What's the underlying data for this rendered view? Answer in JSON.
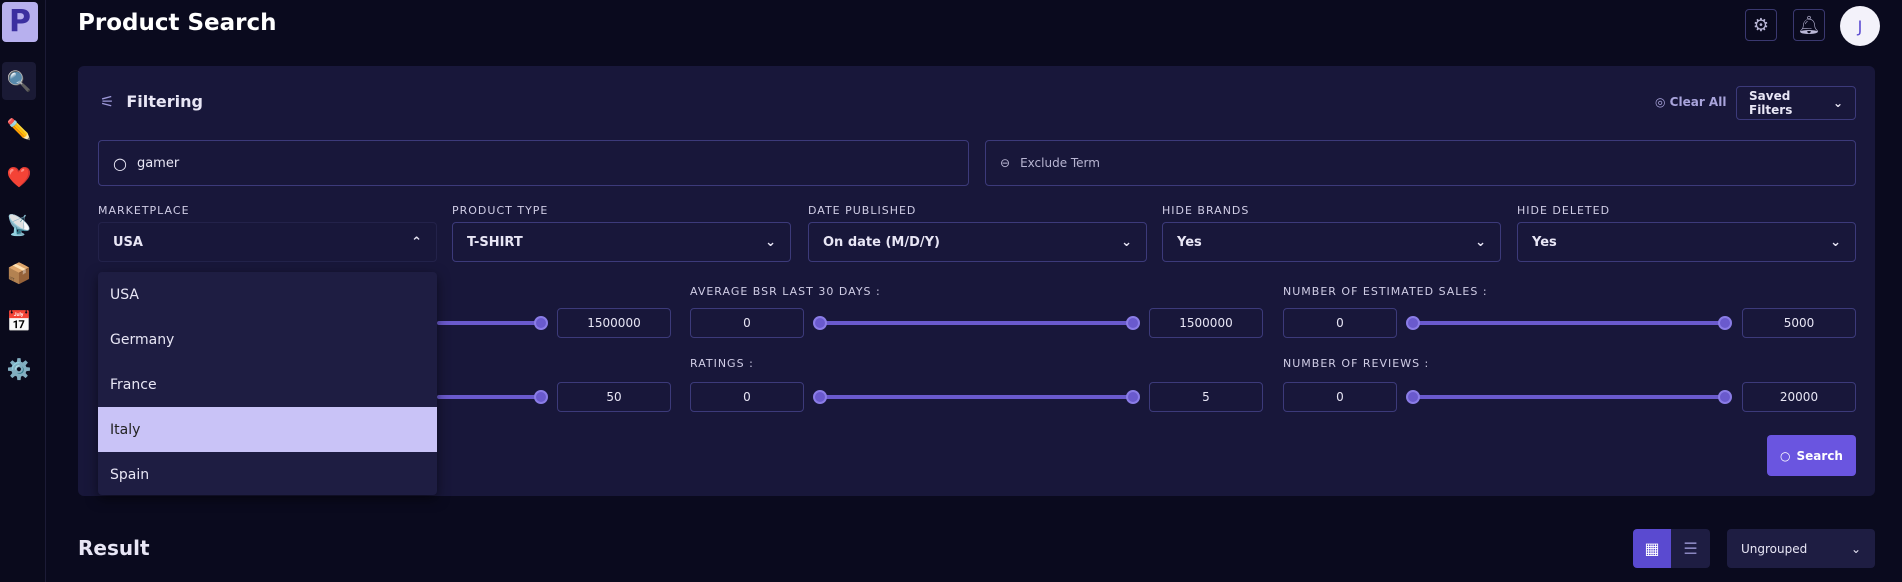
{
  "sidebar": {
    "logo": "P",
    "items": [
      {
        "icon": "magnifier-icon",
        "glyph": "🔍",
        "active": true
      },
      {
        "icon": "pencil-icon",
        "glyph": "✏️"
      },
      {
        "icon": "heart-icon",
        "glyph": "❤️"
      },
      {
        "icon": "satellite-dish-icon",
        "glyph": "📡"
      },
      {
        "icon": "box-icon",
        "glyph": "📦"
      },
      {
        "icon": "calendar-icon",
        "glyph": "📅"
      },
      {
        "icon": "gear-icon",
        "glyph": "⚙️"
      }
    ]
  },
  "header": {
    "title": "Product Search",
    "avatar": "J"
  },
  "filtering": {
    "title": "Filtering",
    "clear_all": "Clear All",
    "saved_filters": "Saved Filters",
    "search": {
      "value": "gamer"
    },
    "exclude": {
      "placeholder": "Exclude Term"
    },
    "selects": [
      {
        "label": "MARKETPLACE",
        "value": "USA"
      },
      {
        "label": "PRODUCT TYPE",
        "value": "T-SHIRT"
      },
      {
        "label": "DATE PUBLISHED",
        "value": "On date (M/D/Y)"
      },
      {
        "label": "HIDE BRANDS",
        "value": "Yes"
      },
      {
        "label": "HIDE DELETED",
        "value": "Yes"
      }
    ],
    "marketplace_options": [
      "USA",
      "Germany",
      "France",
      "Italy",
      "Spain"
    ],
    "highlighted_option": "Italy",
    "ranges": [
      {
        "label": "",
        "min": "",
        "max": "1500000"
      },
      {
        "label": "AVERAGE BSR LAST 30 DAYS :",
        "min": "0",
        "max": "1500000"
      },
      {
        "label": "NUMBER OF ESTIMATED SALES :",
        "min": "0",
        "max": "5000"
      },
      {
        "label": "",
        "min": "",
        "max": "50"
      },
      {
        "label": "RATINGS :",
        "min": "0",
        "max": "5"
      },
      {
        "label": "NUMBER OF REVIEWS :",
        "min": "0",
        "max": "20000"
      }
    ],
    "search_button": "Search"
  },
  "result": {
    "title": "Result",
    "grouping": "Ungrouped"
  },
  "colors": {
    "accent": "#6a55e0",
    "background": "#0a0a1e",
    "panel": "#18173a"
  }
}
